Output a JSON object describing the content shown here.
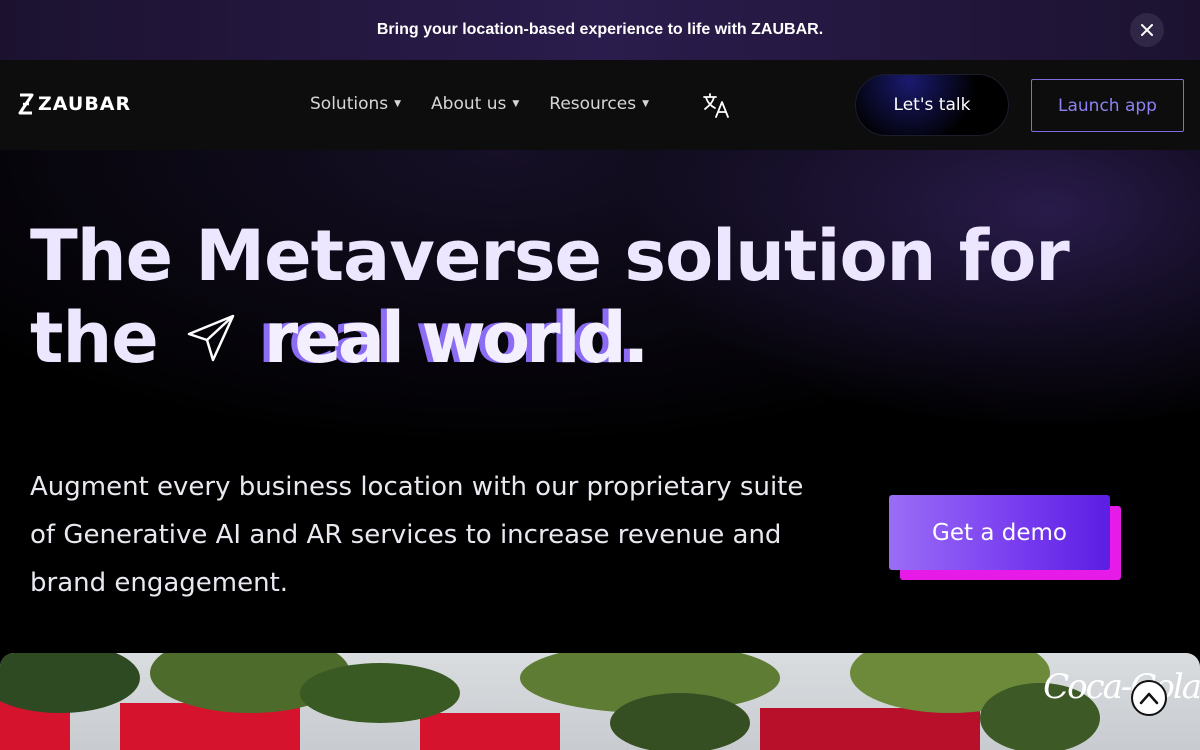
{
  "announcement": {
    "text": "Bring your location-based experience to life with ZAUBAR.",
    "close_icon": "close-icon"
  },
  "nav": {
    "logo_text": "ZAUBAR",
    "menu": [
      {
        "label": "Solutions",
        "icon": "caret-down-icon"
      },
      {
        "label": "About us",
        "icon": "caret-down-icon"
      },
      {
        "label": "Resources",
        "icon": "caret-down-icon"
      }
    ],
    "translate_icon": "translate-icon",
    "lets_talk_label": "Let's talk",
    "launch_app_label": "Launch app"
  },
  "hero": {
    "headline_line1": "The Metaverse solution for",
    "headline_the": "the",
    "headline_highlight": "real world.",
    "send_icon": "send-icon",
    "subtext": "Augment every business location with our proprietary suite of Generative AI and AR services to increase revenue and brand engagement.",
    "cta_label": "Get a demo"
  },
  "media": {
    "brand_logo": "Coca-Cola",
    "scroll_top_icon": "chevron-up-icon"
  },
  "colors": {
    "accent_purple": "#8c6cf5",
    "cta_gradient_start": "#9a6df6",
    "cta_gradient_end": "#5b1ee3",
    "cta_shadow": "#e61be8",
    "launch_border": "#7b6fe0"
  }
}
